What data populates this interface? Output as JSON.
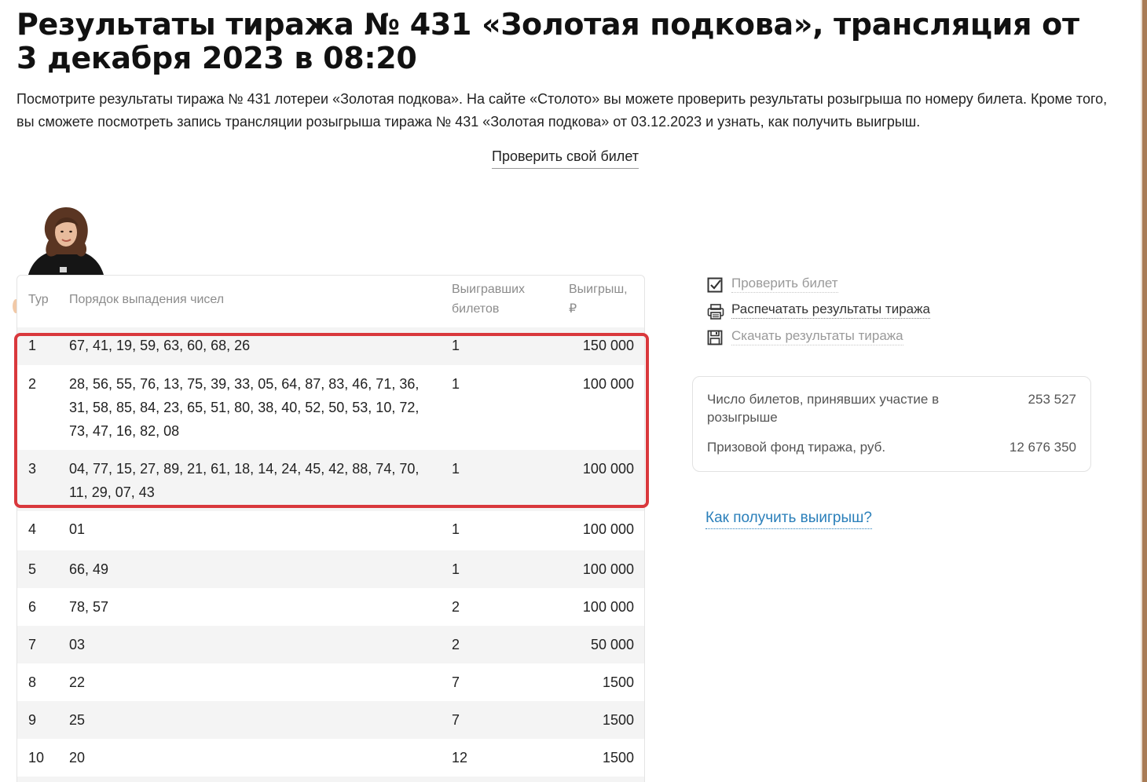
{
  "header": {
    "title": "Результаты тиража № 431 «Золотая подкова», трансляция от 3 декабря 2023 в 08:20",
    "intro": "Посмотрите результаты тиража № 431 лотереи «Золотая подкова». На сайте «Столото» вы можете проверить результаты розыгрыша по номеру билета. Кроме того, вы сможете посмотреть запись трансляции розыгрыша тиража № 431 «Золотая подкова» от 03.12.2023 и узнать, как получить выигрыш.",
    "check_ticket_link": "Проверить свой билет"
  },
  "table": {
    "headers": {
      "tour": "Тур",
      "numbers": "Порядок выпадения чисел",
      "winners_line1": "Выигравших",
      "winners_line2": "билетов",
      "prize_line1": "Выигрыш,",
      "prize_line2": "₽"
    },
    "rows": [
      {
        "tour": "1",
        "numbers": "67, 41, 19, 59, 63, 60, 68, 26",
        "winners": "1",
        "prize": "150 000"
      },
      {
        "tour": "2",
        "numbers": "28, 56, 55, 76, 13, 75, 39, 33, 05, 64, 87, 83, 46, 71, 36, 31, 58, 85, 84, 23, 65, 51, 80, 38, 40, 52, 50, 53, 10, 72, 73, 47, 16, 82, 08",
        "winners": "1",
        "prize": "100 000"
      },
      {
        "tour": "3",
        "numbers": "04, 77, 15, 27, 89, 21, 61, 18, 14, 24, 45, 42, 88, 74, 70, 11, 29, 07, 43",
        "winners": "1",
        "prize": "100 000"
      },
      {
        "tour": "4",
        "numbers": "01",
        "winners": "1",
        "prize": "100 000"
      },
      {
        "tour": "5",
        "numbers": "66, 49",
        "winners": "1",
        "prize": "100 000"
      },
      {
        "tour": "6",
        "numbers": "78, 57",
        "winners": "2",
        "prize": "100 000"
      },
      {
        "tour": "7",
        "numbers": "03",
        "winners": "2",
        "prize": "50 000"
      },
      {
        "tour": "8",
        "numbers": "22",
        "winners": "7",
        "prize": "1500"
      },
      {
        "tour": "9",
        "numbers": "25",
        "winners": "7",
        "prize": "1500"
      },
      {
        "tour": "10",
        "numbers": "20",
        "winners": "12",
        "prize": "1500"
      }
    ]
  },
  "actions": {
    "check_ticket": "Проверить билет",
    "print_results": "Распечатать результаты тиража",
    "download_results": "Скачать результаты тиража"
  },
  "info": {
    "participants_label": "Число билетов, принявших участие в розыгрыше",
    "participants_value": "253 527",
    "prize_fund_label": "Призовой фонд тиража, руб.",
    "prize_fund_value": "12 676 350"
  },
  "how_to_get_prize": "Как получить выигрыш?",
  "colors": {
    "highlight": "#d9383c",
    "link": "#2a7fba",
    "row_alt": "#f4f4f4"
  }
}
